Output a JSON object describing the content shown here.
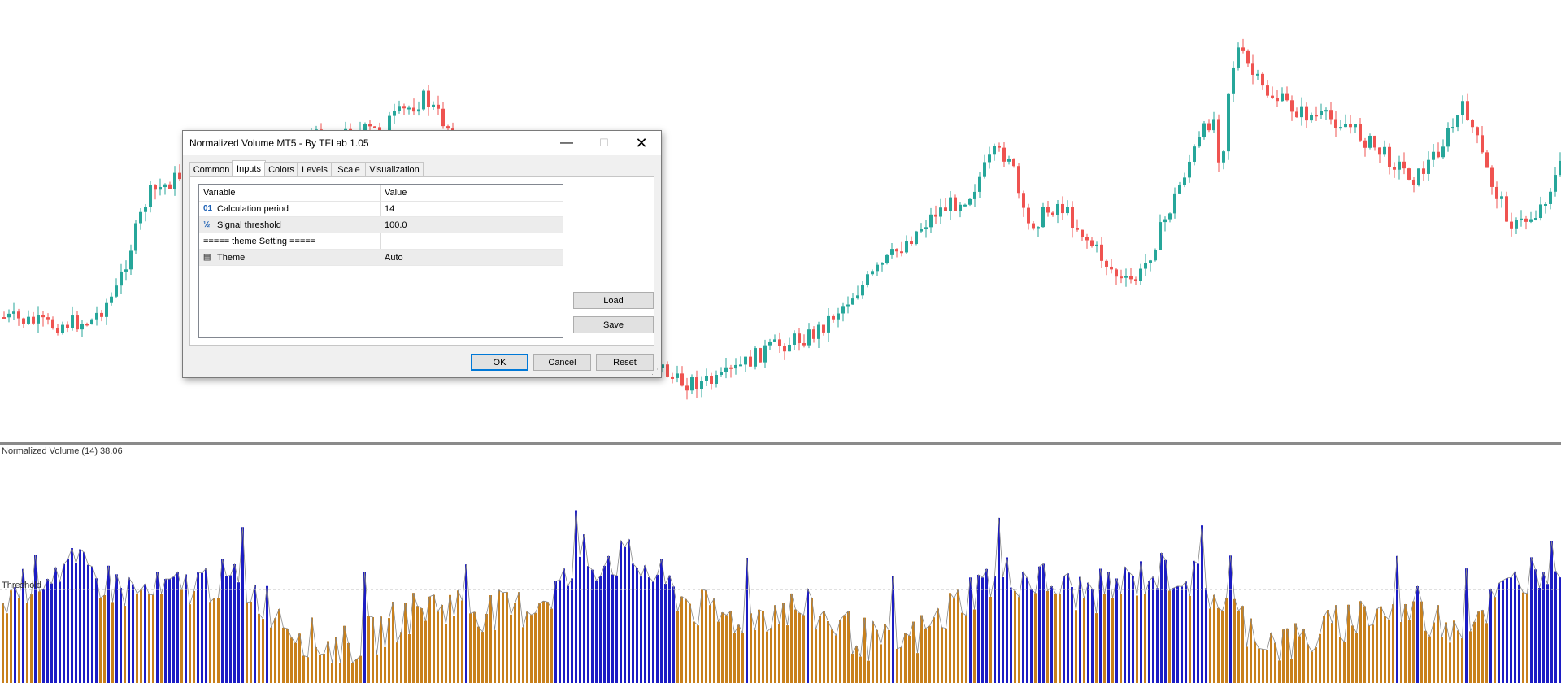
{
  "dialog": {
    "title": "Normalized Volume MT5 - By TFLab 1.05",
    "window_controls": {
      "minimize": "—",
      "maximize": "☐",
      "close": "✕"
    },
    "tabs": [
      "Common",
      "Inputs",
      "Colors",
      "Levels",
      "Scale",
      "Visualization"
    ],
    "active_tab": "Inputs",
    "grid_headers": {
      "variable": "Variable",
      "value": "Value"
    },
    "rows": [
      {
        "icon": "integer-param-icon",
        "icon_glyph": "01",
        "name": "Calculation period",
        "value": "14"
      },
      {
        "icon": "double-param-icon",
        "icon_glyph": "½",
        "name": "Signal threshold",
        "value": "100.0"
      },
      {
        "icon": "",
        "icon_glyph": "",
        "name": "===== theme Setting =====",
        "value": ""
      },
      {
        "icon": "enum-param-icon",
        "icon_glyph": "▤",
        "name": "Theme",
        "value": "Auto"
      }
    ],
    "side_buttons": {
      "load": "Load",
      "save": "Save"
    },
    "footer_buttons": {
      "ok": "OK",
      "cancel": "Cancel",
      "reset": "Reset"
    }
  },
  "indicator": {
    "title": "Normalized Volume (14) 38.06",
    "threshold_label": "Threshold"
  },
  "colors": {
    "bull": "#26a69a",
    "bear": "#ef5350",
    "volume_above": "#1c1cc4",
    "volume_below": "#c8801c",
    "threshold_line": "#c0c0c0",
    "outline": "#888888"
  },
  "chart_data": {
    "type": "bar",
    "threshold": 100,
    "note_series": "volume bars colored blue when above threshold, orange when below"
  }
}
